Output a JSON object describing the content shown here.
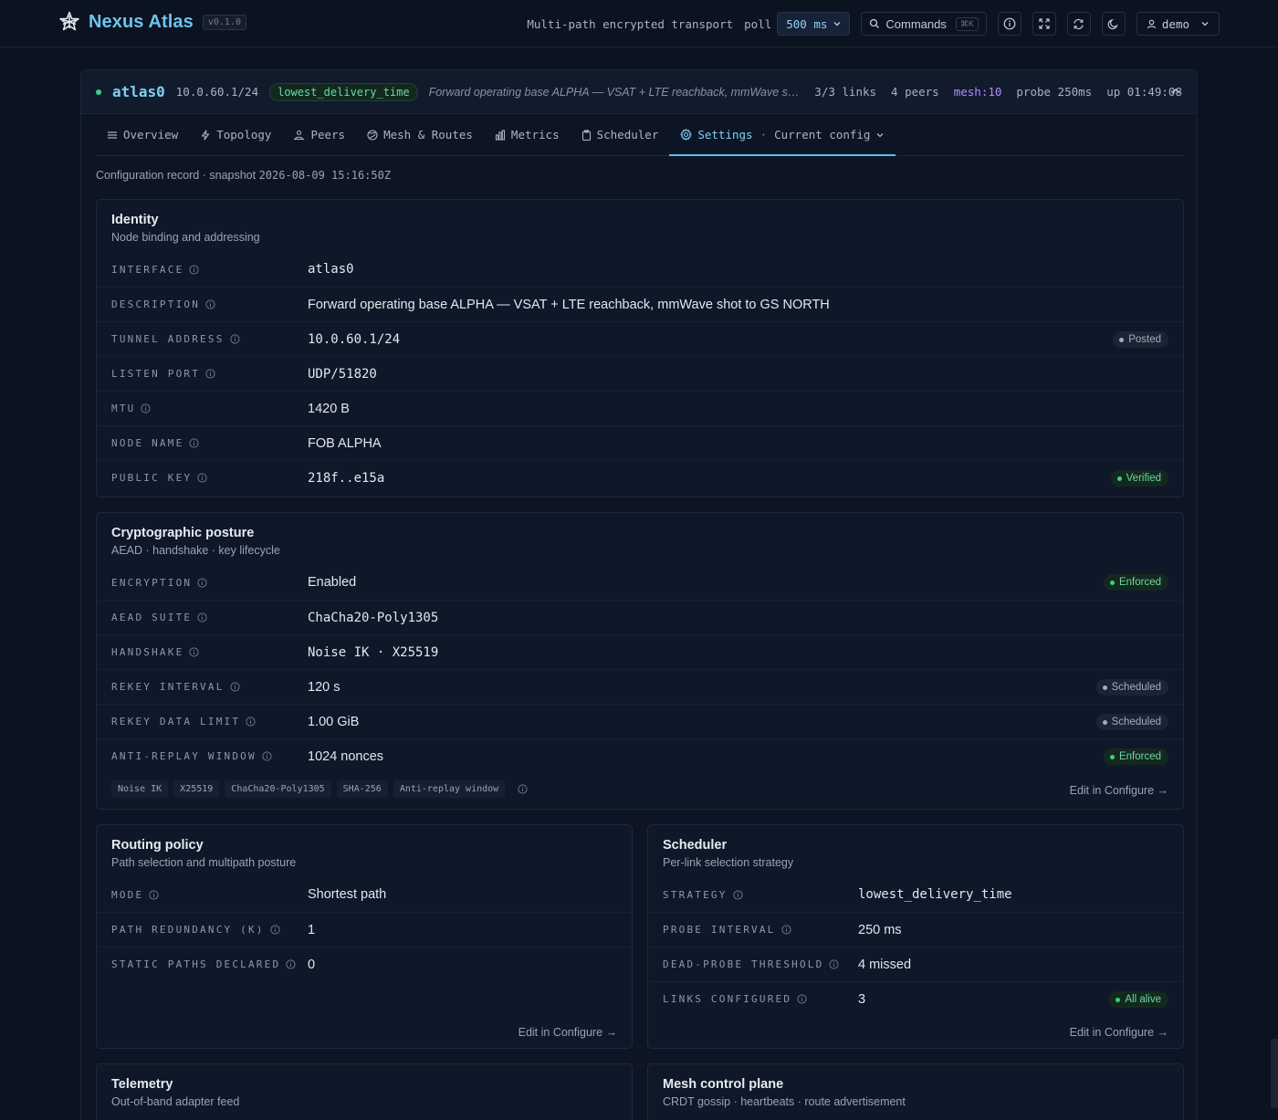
{
  "app": {
    "name": "Nexus Atlas",
    "version": "v0.1.0",
    "transport_label": "Multi-path encrypted transport",
    "poll_label": "poll",
    "poll_value": "500 ms",
    "commands_label": "Commands",
    "commands_shortcut": "⌘K",
    "user": "demo"
  },
  "iface": {
    "name": "atlas0",
    "address": "10.0.60.1/24",
    "scheduler": "lowest_delivery_time",
    "description": "Forward operating base ALPHA — VSAT + LTE reachback, mmWave sh...",
    "links": "3/3 links",
    "peers": "4 peers",
    "mesh": "mesh:10",
    "probe": "probe 250ms",
    "uptime": "up 01:49:08"
  },
  "tabs": [
    {
      "label": "Overview",
      "icon": "list-icon"
    },
    {
      "label": "Topology",
      "icon": "lightning-icon"
    },
    {
      "label": "Peers",
      "icon": "users-icon"
    },
    {
      "label": "Mesh & Routes",
      "icon": "globe-icon"
    },
    {
      "label": "Metrics",
      "icon": "bar-chart-icon"
    },
    {
      "label": "Scheduler",
      "icon": "clipboard-icon"
    },
    {
      "label": "Settings",
      "icon": "gear-icon",
      "sub": "Current config",
      "active": true
    }
  ],
  "record": {
    "prefix": "Configuration record · snapshot ",
    "timestamp": "2026-08-09 15:16:50Z"
  },
  "identity": {
    "title": "Identity",
    "subtitle": "Node binding and addressing",
    "rows": [
      {
        "label": "INTERFACE",
        "value": "atlas0",
        "mono": true
      },
      {
        "label": "DESCRIPTION",
        "value": "Forward operating base ALPHA — VSAT + LTE reachback, mmWave shot to GS NORTH"
      },
      {
        "label": "TUNNEL ADDRESS",
        "value": "10.0.60.1/24",
        "mono": true,
        "badge": "Posted",
        "badge_tone": "grey"
      },
      {
        "label": "LISTEN PORT",
        "value": "UDP/51820",
        "mono": true
      },
      {
        "label": "MTU",
        "value": "1420 B"
      },
      {
        "label": "NODE NAME",
        "value": "FOB ALPHA"
      },
      {
        "label": "PUBLIC KEY",
        "value": "218f..e15a",
        "mono": true,
        "badge": "Verified",
        "badge_tone": "green"
      }
    ]
  },
  "crypto": {
    "title": "Cryptographic posture",
    "subtitle": "AEAD · handshake · key lifecycle",
    "rows": [
      {
        "label": "ENCRYPTION",
        "value": "Enabled",
        "badge": "Enforced",
        "badge_tone": "green"
      },
      {
        "label": "AEAD SUITE",
        "value": "ChaCha20-Poly1305",
        "mono": true
      },
      {
        "label": "HANDSHAKE",
        "value": "Noise IK · X25519",
        "mono": true
      },
      {
        "label": "REKEY INTERVAL",
        "value": "120 s",
        "badge": "Scheduled",
        "badge_tone": "grey"
      },
      {
        "label": "REKEY DATA LIMIT",
        "value": "1.00 GiB",
        "badge": "Scheduled",
        "badge_tone": "grey"
      },
      {
        "label": "ANTI-REPLAY WINDOW",
        "value": "1024 nonces",
        "badge": "Enforced",
        "badge_tone": "green"
      }
    ],
    "chips": [
      "Noise IK",
      "X25519",
      "ChaCha20-Poly1305",
      "SHA-256",
      "Anti-replay window"
    ],
    "edit_label": "Edit in Configure →"
  },
  "routing": {
    "title": "Routing policy",
    "subtitle": "Path selection and multipath posture",
    "rows": [
      {
        "label": "MODE",
        "value": "Shortest path"
      },
      {
        "label": "PATH REDUNDANCY (K)",
        "value": "1"
      },
      {
        "label": "STATIC PATHS DECLARED",
        "value": "0"
      }
    ],
    "edit_label": "Edit in Configure →"
  },
  "scheduler": {
    "title": "Scheduler",
    "subtitle": "Per-link selection strategy",
    "rows": [
      {
        "label": "STRATEGY",
        "value": "lowest_delivery_time",
        "mono": true
      },
      {
        "label": "PROBE INTERVAL",
        "value": "250 ms"
      },
      {
        "label": "DEAD-PROBE THRESHOLD",
        "value": "4 missed"
      },
      {
        "label": "LINKS CONFIGURED",
        "value": "3",
        "badge": "All alive",
        "badge_tone": "green"
      }
    ],
    "edit_label": "Edit in Configure →"
  },
  "telemetry": {
    "title": "Telemetry",
    "subtitle": "Out-of-band adapter feed"
  },
  "mesh_plane": {
    "title": "Mesh control plane",
    "subtitle": "CRDT gossip · heartbeats · route advertisement"
  }
}
